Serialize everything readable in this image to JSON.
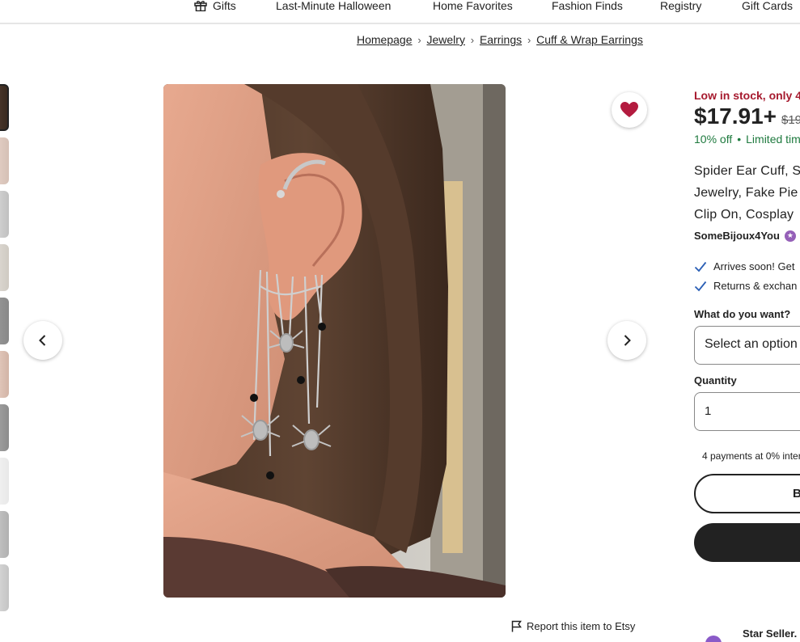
{
  "nav": {
    "items": [
      "Gifts",
      "Last-Minute Halloween",
      "Home Favorites",
      "Fashion Finds",
      "Registry",
      "Gift Cards"
    ]
  },
  "breadcrumb": [
    "Homepage",
    "Jewelry",
    "Earrings",
    "Cuff & Wrap Earrings"
  ],
  "product": {
    "stock_notice": "Low in stock, only 4 l",
    "price": "$17.91+",
    "original_price": "$19.",
    "discount": "10% off",
    "discount_sep": "•",
    "limited": "Limited tim",
    "title_lines": [
      "Spider Ear Cuff, S",
      "Jewelry, Fake Pie",
      "Clip On, Cosplay"
    ],
    "shop_name": "SomeBijoux4You",
    "features": [
      "Arrives soon! Get",
      "Returns & exchan"
    ],
    "variant_label": "What do you want?",
    "variant_value": "Select an option",
    "quantity_label": "Quantity",
    "quantity_value": "1",
    "payments": "4 payments at 0% inter",
    "buy_now_label": "B",
    "star_seller": "Star Seller."
  },
  "report_link": "Report this item to Etsy",
  "colors": {
    "stock_red": "#a61a2e",
    "discount_green": "#1f7a3f",
    "favorite_red": "#b31b3f",
    "star_purple": "#9560b8"
  },
  "icons": [
    "gift-icon",
    "chevron-right-icon",
    "chevron-left-icon",
    "heart-icon",
    "flag-icon",
    "check-icon",
    "star-seller-icon"
  ]
}
